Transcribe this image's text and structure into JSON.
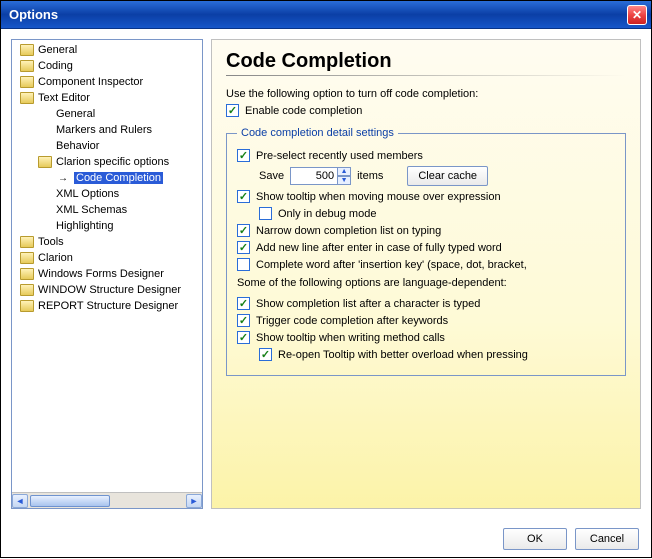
{
  "window": {
    "title": "Options"
  },
  "tree": {
    "items": [
      {
        "label": "General",
        "depth": 0,
        "icon": "folder"
      },
      {
        "label": "Coding",
        "depth": 0,
        "icon": "folder"
      },
      {
        "label": "Component Inspector",
        "depth": 0,
        "icon": "folder"
      },
      {
        "label": "Text Editor",
        "depth": 0,
        "icon": "folder"
      },
      {
        "label": "General",
        "depth": 1,
        "icon": "none"
      },
      {
        "label": "Markers and Rulers",
        "depth": 1,
        "icon": "none"
      },
      {
        "label": "Behavior",
        "depth": 1,
        "icon": "none"
      },
      {
        "label": "Clarion specific options",
        "depth": 1,
        "icon": "folder"
      },
      {
        "label": "Code Completion",
        "depth": 2,
        "icon": "arrow",
        "selected": true
      },
      {
        "label": "XML Options",
        "depth": 1,
        "icon": "none"
      },
      {
        "label": "XML Schemas",
        "depth": 1,
        "icon": "none"
      },
      {
        "label": "Highlighting",
        "depth": 1,
        "icon": "none"
      },
      {
        "label": "Tools",
        "depth": 0,
        "icon": "folder"
      },
      {
        "label": "Clarion",
        "depth": 0,
        "icon": "folder"
      },
      {
        "label": "Windows Forms Designer",
        "depth": 0,
        "icon": "folder"
      },
      {
        "label": "WINDOW Structure Designer",
        "depth": 0,
        "icon": "folder"
      },
      {
        "label": "REPORT Structure Designer",
        "depth": 0,
        "icon": "folder"
      }
    ]
  },
  "content": {
    "heading": "Code Completion",
    "intro": "Use the following option to turn off code completion:",
    "enable_label": "Enable code completion",
    "fieldset_legend": "Code completion detail settings",
    "preselect_label": "Pre-select recently used members",
    "save_label": "Save",
    "save_value": "500",
    "items_label": "items",
    "clear_cache_label": "Clear cache",
    "tooltip_mouse_label": "Show tooltip when moving mouse over expression",
    "only_debug_label": "Only in debug mode",
    "narrow_label": "Narrow down completion list on typing",
    "newline_label": "Add new line after enter in case of fully typed word",
    "complete_after_key_label": "Complete word after 'insertion key' (space, dot, bracket,",
    "lang_dep_label": "Some of the following options are language-dependent:",
    "show_after_char_label": "Show completion list after a character is typed",
    "trigger_keywords_label": "Trigger code completion after keywords",
    "tooltip_method_label": "Show tooltip when writing method calls",
    "reopen_tooltip_label": "Re-open Tooltip with better overload when pressing"
  },
  "footer": {
    "ok_label": "OK",
    "cancel_label": "Cancel"
  }
}
